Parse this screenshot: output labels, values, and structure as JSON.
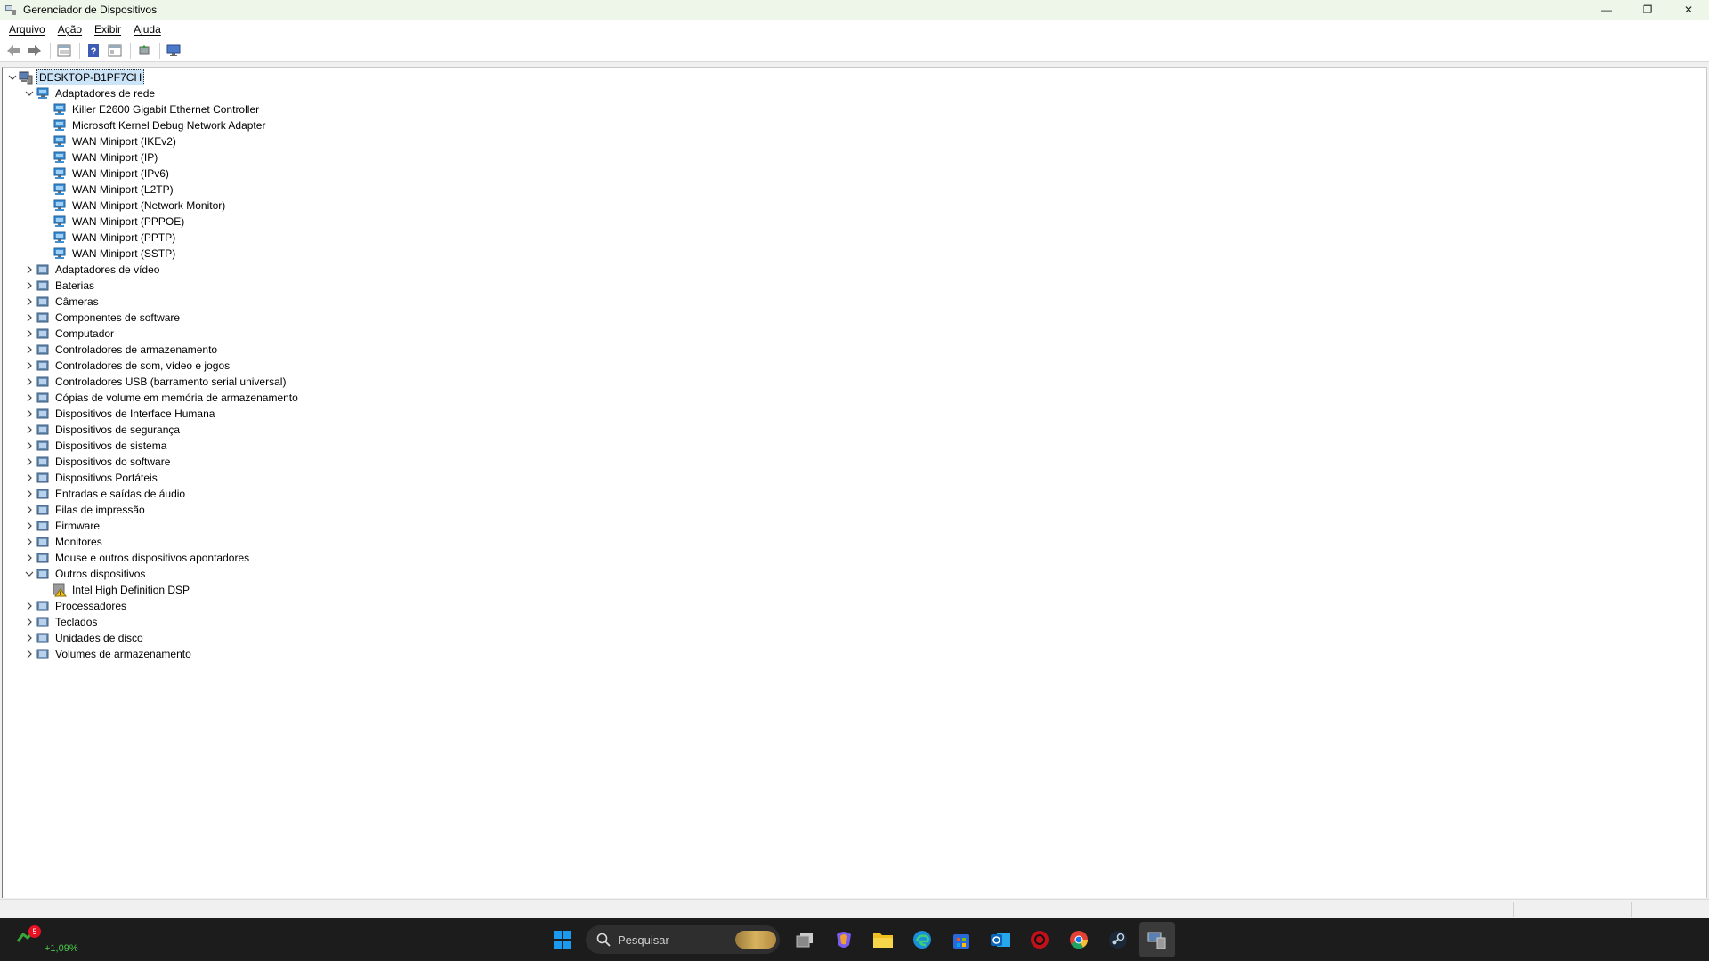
{
  "window": {
    "title": "Gerenciador de Dispositivos",
    "controls": {
      "minimize": "—",
      "restore": "❐",
      "close": "✕"
    }
  },
  "menu": [
    "Arquivo",
    "Ação",
    "Exibir",
    "Ajuda"
  ],
  "toolbar": [
    "back-icon",
    "forward-icon",
    "properties-icon",
    "help-icon",
    "view-icon",
    "update-driver-icon",
    "monitor-icon"
  ],
  "tree": {
    "root": "DESKTOP-B1PF7CH",
    "nodes": [
      {
        "label": "Adaptadores de rede",
        "expanded": true,
        "icon": "network-adapter-icon",
        "children": [
          "Killer E2600 Gigabit Ethernet Controller",
          "Microsoft Kernel Debug Network Adapter",
          "WAN Miniport (IKEv2)",
          "WAN Miniport (IP)",
          "WAN Miniport (IPv6)",
          "WAN Miniport (L2TP)",
          "WAN Miniport (Network Monitor)",
          "WAN Miniport (PPPOE)",
          "WAN Miniport (PPTP)",
          "WAN Miniport (SSTP)"
        ]
      },
      {
        "label": "Adaptadores de vídeo",
        "icon": "display-adapter-icon"
      },
      {
        "label": "Baterias",
        "icon": "battery-icon"
      },
      {
        "label": "Câmeras",
        "icon": "camera-icon"
      },
      {
        "label": "Componentes de software",
        "icon": "software-component-icon"
      },
      {
        "label": "Computador",
        "icon": "computer-icon"
      },
      {
        "label": "Controladores de armazenamento",
        "icon": "storage-controller-icon"
      },
      {
        "label": "Controladores de som, vídeo e jogos",
        "icon": "sound-icon"
      },
      {
        "label": "Controladores USB (barramento serial universal)",
        "icon": "usb-icon"
      },
      {
        "label": "Cópias de volume em memória de armazenamento",
        "icon": "volume-shadow-icon"
      },
      {
        "label": "Dispositivos de Interface Humana",
        "icon": "hid-icon"
      },
      {
        "label": "Dispositivos de segurança",
        "icon": "security-device-icon"
      },
      {
        "label": "Dispositivos de sistema",
        "icon": "system-device-icon"
      },
      {
        "label": "Dispositivos do software",
        "icon": "software-device-icon"
      },
      {
        "label": "Dispositivos Portáteis",
        "icon": "portable-device-icon"
      },
      {
        "label": "Entradas e saídas de áudio",
        "icon": "audio-io-icon"
      },
      {
        "label": "Filas de impressão",
        "icon": "printer-icon"
      },
      {
        "label": "Firmware",
        "icon": "firmware-icon"
      },
      {
        "label": "Monitores",
        "icon": "monitor-icon"
      },
      {
        "label": "Mouse e outros dispositivos apontadores",
        "icon": "mouse-icon"
      },
      {
        "label": "Outros dispositivos",
        "expanded": true,
        "icon": "other-devices-icon",
        "children": [
          "Intel High Definition DSP"
        ]
      },
      {
        "label": "Processadores",
        "icon": "processor-icon"
      },
      {
        "label": "Teclados",
        "icon": "keyboard-icon"
      },
      {
        "label": "Unidades de disco",
        "icon": "disk-drive-icon"
      },
      {
        "label": "Volumes de armazenamento",
        "icon": "storage-volume-icon"
      }
    ]
  },
  "taskbar": {
    "stock_badge": "5",
    "stock_change": "+1,09%",
    "search_placeholder": "Pesquisar",
    "apps": [
      "start-icon",
      "search-box",
      "task-view-icon",
      "copilot-icon",
      "file-explorer-icon",
      "edge-icon",
      "store-icon",
      "outlook-icon",
      "security-app-icon",
      "chrome-icon",
      "steam-icon",
      "device-manager-icon"
    ]
  }
}
